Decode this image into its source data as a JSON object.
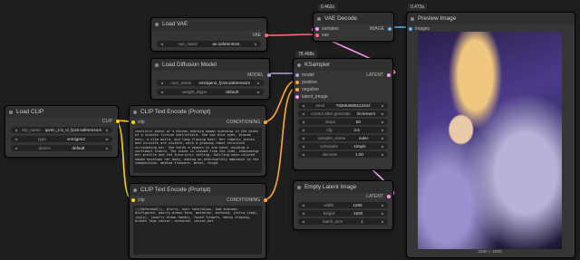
{
  "colors": {
    "clip": "#ffd500",
    "conditioning": "#ffa931",
    "model": "#b39ddb",
    "vae": "#ff6e6e",
    "latent": "#ff9cf9",
    "image": "#64b5f6"
  },
  "timings": {
    "vae_decode": "0.462s",
    "ksampler": "78.468s",
    "preview": "0.473s"
  },
  "load_vae": {
    "title": "Load VAE",
    "output": "VAE",
    "widget_label": "vae_name",
    "widget_value": "ae.safetensors"
  },
  "vae_decode": {
    "title": "VAE Decode",
    "inputs": [
      "samples",
      "vae"
    ],
    "output": "IMAGE"
  },
  "preview_image": {
    "title": "Preview Image",
    "input": "images",
    "caption": "1280 × 1920"
  },
  "load_diffusion": {
    "title": "Load Diffusion Model",
    "output": "MODEL",
    "widgets": [
      {
        "label": "unet_name",
        "value": "omnigen2_fp16.safetensors"
      },
      {
        "label": "weight_dtype",
        "value": "default"
      }
    ]
  },
  "ksampler": {
    "title": "KSampler",
    "inputs": [
      "model",
      "positive",
      "negative",
      "latent_image"
    ],
    "output": "LATENT",
    "widgets": [
      {
        "label": "seed",
        "value": "782664668113342"
      },
      {
        "label": "control after generate",
        "value": "increment"
      },
      {
        "label": "steps",
        "value": "50"
      },
      {
        "label": "cfg",
        "value": "3.5"
      },
      {
        "label": "sampler_name",
        "value": "euler"
      },
      {
        "label": "scheduler",
        "value": "simple"
      },
      {
        "label": "denoise",
        "value": "1.00"
      }
    ]
  },
  "load_clip": {
    "title": "Load CLIP",
    "output": "CLIP",
    "widgets": [
      {
        "label": "clip_name",
        "value": "qwen_2.5_vl_fp16.safetensors"
      },
      {
        "label": "type",
        "value": "omnigen2"
      },
      {
        "label": "device",
        "value": "default"
      }
    ]
  },
  "clip_pos": {
    "title": "CLIP Text Encode (Prompt)",
    "input": "clip",
    "output": "CONDITIONING",
    "text": "realistic photo of a Korean android woman standing in the midst of a science fiction battlefield. She has blue eyes, blonde hair, a slim build, and long flowing hair. Her robotic joints and circuits are visible, with a glowing robot structure surrounding her. She holds a weapon in one hand, exuding a confident stance. The scene is viewed from the side, showcasing her profile and the futuristic setting. Swirling neon-colored smoke envelops her body, adding an otherworldly ambiance to the composition. medium trousers, metal, thigh."
  },
  "clip_neg": {
    "title": "CLIP Text Encode (Prompt)",
    "input": "clip",
    "output": "CONDITIONING",
    "text": "(((deformed))), blurry, over saturation, bad anatomy, disfigured, poorly drawn face, mutation, mutated, (extra_limb), (ugly), (poorly drawn hands), fused fingers, messy drawing, broken legs censor, censored, censor_bar"
  },
  "empty_latent": {
    "title": "Empty Latent Image",
    "output": "LATENT",
    "widgets": [
      {
        "label": "width",
        "value": "1280"
      },
      {
        "label": "height",
        "value": "1920"
      },
      {
        "label": "batch_size",
        "value": "1"
      }
    ]
  }
}
